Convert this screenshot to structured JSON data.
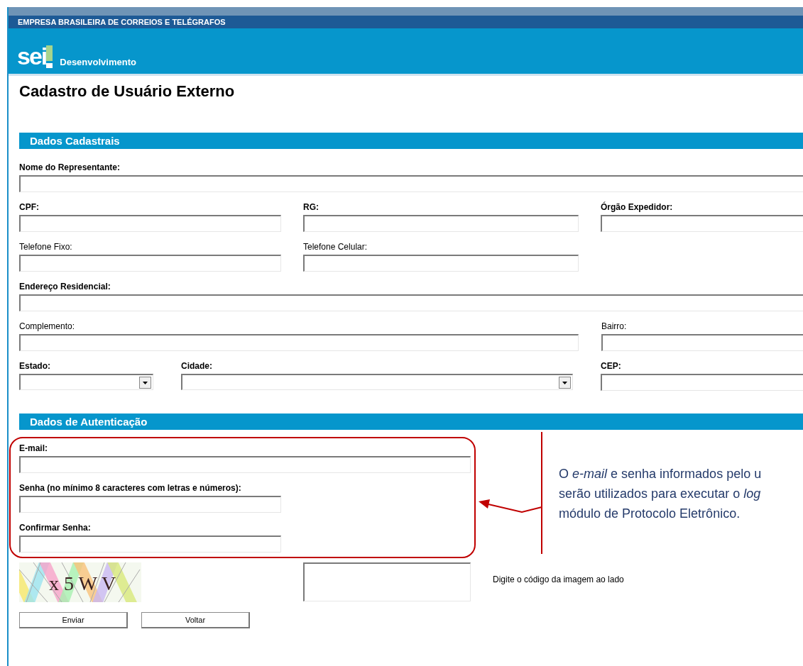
{
  "header": {
    "organization": "EMPRESA BRASILEIRA DE CORREIOS E TELÉGRAFOS",
    "logo": "sei",
    "environment": "Desenvolvimento"
  },
  "title": "Cadastro de Usuário Externo",
  "sections": [
    {
      "title": "Dados Cadastrais",
      "fields": [
        {
          "label": "Nome do Representante:",
          "required": true,
          "kind": "text"
        },
        {
          "label": "CPF:",
          "required": true,
          "kind": "text"
        },
        {
          "label": "RG:",
          "required": true,
          "kind": "text"
        },
        {
          "label": "Órgão Expedidor:",
          "required": true,
          "kind": "text"
        },
        {
          "label": "Telefone Fixo:",
          "required": false,
          "kind": "text"
        },
        {
          "label": "Telefone Celular:",
          "required": false,
          "kind": "text"
        },
        {
          "label": "Endereço Residencial:",
          "required": true,
          "kind": "text"
        },
        {
          "label": "Complemento:",
          "required": false,
          "kind": "text"
        },
        {
          "label": "Bairro:",
          "required": false,
          "kind": "text"
        },
        {
          "label": "Estado:",
          "required": true,
          "kind": "select"
        },
        {
          "label": "Cidade:",
          "required": true,
          "kind": "select"
        },
        {
          "label": "CEP:",
          "required": true,
          "kind": "text"
        }
      ]
    },
    {
      "title": "Dados de Autenticação",
      "fields": [
        {
          "label": "E-mail:",
          "required": true,
          "kind": "text"
        },
        {
          "label": "Senha (no mínimo 8 caracteres com letras e números):",
          "required": true,
          "kind": "password"
        },
        {
          "label": "Confirmar Senha:",
          "required": true,
          "kind": "password"
        }
      ]
    }
  ],
  "captcha": {
    "code": "x 5 W V",
    "hint": "Digite o código da imagem ao lado"
  },
  "buttons": [
    "Enviar",
    "Voltar"
  ],
  "callout": {
    "lines": [
      "O *e-mail* e senha informados pelo u",
      "serão utilizados para executar o *log*",
      "módulo de Protocolo Eletrônico."
    ]
  }
}
